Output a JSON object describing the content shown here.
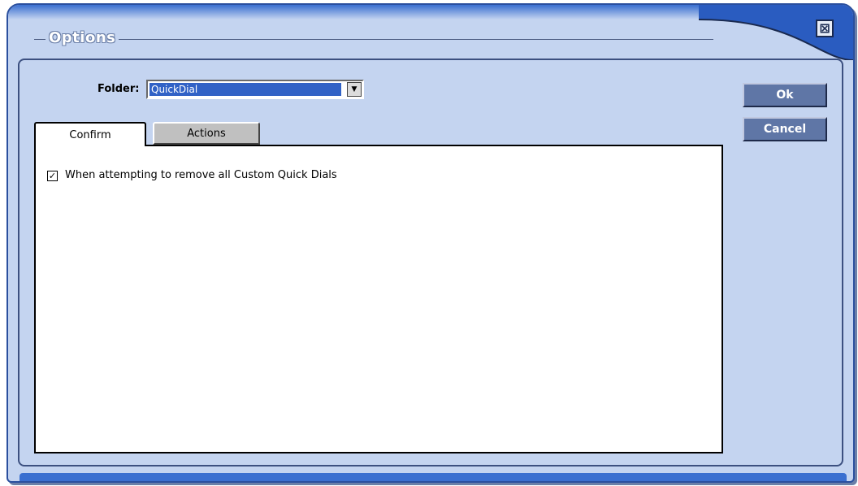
{
  "window": {
    "title": "Options",
    "close_symbol": "⊠"
  },
  "folder": {
    "label": "Folder:",
    "selected_value": "QuickDial",
    "dropdown_symbol": "▼"
  },
  "buttons": {
    "ok_label": "Ok",
    "cancel_label": "Cancel"
  },
  "tabs": [
    {
      "label": "Confirm",
      "active": true
    },
    {
      "label": "Actions",
      "active": false
    }
  ],
  "confirm_tab": {
    "checkbox_label": "When attempting to remove all Custom Quick Dials",
    "checkbox_checked": true,
    "check_mark": "✓"
  },
  "colors": {
    "frame_blue": "#2a4f9e",
    "panel_bg": "#c4d4f0",
    "button_bg": "#5f76a6",
    "selection_blue": "#3162c6"
  }
}
